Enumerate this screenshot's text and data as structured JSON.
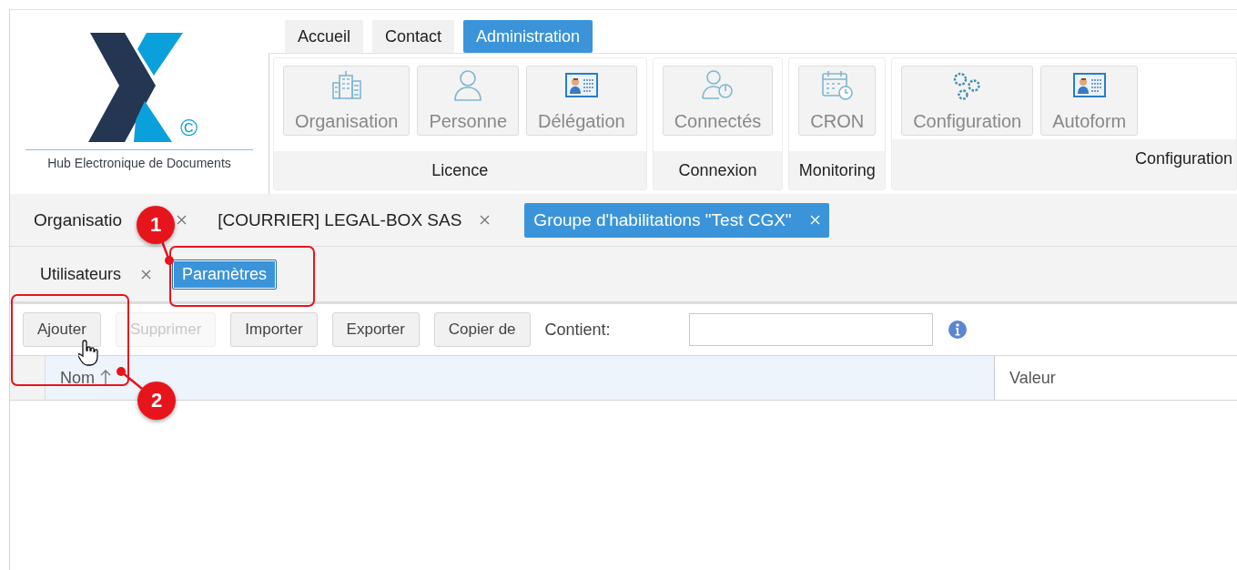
{
  "logo": {
    "mark": "©",
    "caption": "Hub Electronique de Documents"
  },
  "nav": [
    {
      "label": "Accueil",
      "selected": false
    },
    {
      "label": "Contact",
      "selected": false
    },
    {
      "label": "Administration",
      "selected": true
    }
  ],
  "ribbon": [
    {
      "label": "Licence",
      "items": [
        {
          "label": "Organisation",
          "kind": "building"
        },
        {
          "label": "Personne",
          "kind": "person"
        },
        {
          "label": "Délégation",
          "kind": "card"
        }
      ]
    },
    {
      "label": "Connexion",
      "items": [
        {
          "label": "Connectés",
          "kind": "session"
        }
      ]
    },
    {
      "label": "Monitoring",
      "items": [
        {
          "label": "CRON",
          "kind": "calendar"
        }
      ]
    },
    {
      "label": "Configuration",
      "items": [
        {
          "label": "Configuration",
          "kind": "gears"
        },
        {
          "label": "Autoform",
          "kind": "card"
        }
      ]
    }
  ],
  "tabs": [
    {
      "label": "Organisatio",
      "selected": false
    },
    {
      "label": "[COURRIER] LEGAL-BOX SAS",
      "selected": false
    },
    {
      "label": "Groupe d'habilitations \"Test CGX\"",
      "selected": true
    }
  ],
  "subtabs": [
    {
      "label": "Utilisateurs",
      "selected": false
    },
    {
      "label": "Paramètres",
      "selected": true
    }
  ],
  "toolbar": {
    "buttons": [
      {
        "label": "Ajouter",
        "disabled": false
      },
      {
        "label": "Supprimer",
        "disabled": true
      },
      {
        "label": "Importer",
        "disabled": false
      },
      {
        "label": "Exporter",
        "disabled": false
      },
      {
        "label": "Copier de",
        "disabled": false
      }
    ],
    "filter_label": "Contient:"
  },
  "table": {
    "columns": [
      {
        "label": "Nom",
        "sorted": true
      },
      {
        "label": "Valeur",
        "sorted": false
      }
    ]
  },
  "callouts": [
    {
      "number": "1"
    },
    {
      "number": "2"
    }
  ]
}
